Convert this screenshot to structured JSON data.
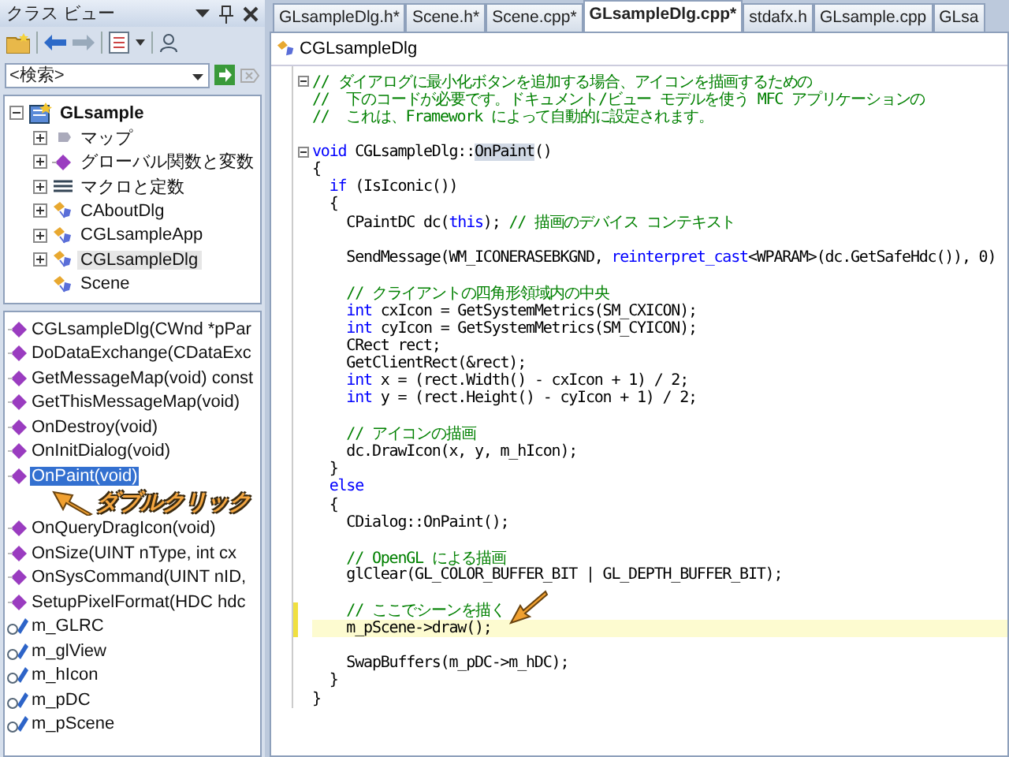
{
  "class_view": {
    "title": "クラス ビュー",
    "search": {
      "placeholder": "<検索>"
    },
    "tree": [
      {
        "label": "GLsample",
        "kind": "project",
        "expanded": true,
        "selected": false,
        "children": [
          {
            "label": "マップ",
            "kind": "map",
            "expanded": false,
            "selected": false
          },
          {
            "label": "グローバル関数と変数",
            "kind": "global",
            "expanded": false,
            "selected": false
          },
          {
            "label": "マクロと定数",
            "kind": "macro",
            "expanded": false,
            "selected": false
          },
          {
            "label": "CAboutDlg",
            "kind": "class",
            "expanded": false,
            "selected": false
          },
          {
            "label": "CGLsampleApp",
            "kind": "class",
            "expanded": false,
            "selected": false
          },
          {
            "label": "CGLsampleDlg",
            "kind": "class",
            "expanded": false,
            "selected": true
          },
          {
            "label": "Scene",
            "kind": "class",
            "selected": false
          }
        ]
      }
    ],
    "members": [
      {
        "label": "CGLsampleDlg(CWnd *pPar",
        "kind": "method",
        "selected": false
      },
      {
        "label": "DoDataExchange(CDataExc",
        "kind": "method",
        "selected": false
      },
      {
        "label": "GetMessageMap(void) const",
        "kind": "method",
        "selected": false
      },
      {
        "label": "GetThisMessageMap(void)",
        "kind": "method",
        "selected": false
      },
      {
        "label": "OnDestroy(void)",
        "kind": "method",
        "selected": false
      },
      {
        "label": "OnInitDialog(void)",
        "kind": "method",
        "selected": false
      },
      {
        "label": "OnPaint(void)",
        "kind": "method",
        "selected": true
      },
      {
        "label": "OnQueryDragIcon(void)",
        "kind": "method",
        "selected": false
      },
      {
        "label": "OnSize(UINT nType, int cx",
        "kind": "method",
        "selected": false
      },
      {
        "label": "OnSysCommand(UINT nID,",
        "kind": "method",
        "selected": false
      },
      {
        "label": "SetupPixelFormat(HDC hdc",
        "kind": "method",
        "selected": false
      },
      {
        "label": "m_GLRC",
        "kind": "field",
        "selected": false
      },
      {
        "label": "m_glView",
        "kind": "field",
        "selected": false
      },
      {
        "label": "m_hIcon",
        "kind": "field",
        "selected": false
      },
      {
        "label": "m_pDC",
        "kind": "field",
        "selected": false
      },
      {
        "label": "m_pScene",
        "kind": "field",
        "selected": false
      }
    ],
    "annotation": "ダブルクリック"
  },
  "editor": {
    "tabs": [
      {
        "label": "GLsampleDlg.h*",
        "selected": false
      },
      {
        "label": "Scene.h*",
        "selected": false
      },
      {
        "label": "Scene.cpp*",
        "selected": false
      },
      {
        "label": "GLsampleDlg.cpp*",
        "selected": true
      },
      {
        "label": "stdafx.h",
        "selected": false
      },
      {
        "label": "GLsample.cpp",
        "selected": false
      },
      {
        "label": "GLsa",
        "selected": false
      }
    ],
    "scope": "CGLsampleDlg",
    "lines": [
      {
        "fold": true,
        "changed": false,
        "highlighted": false,
        "segments": [
          {
            "kind": "comment",
            "text": "// ダイアログに最小化ボタンを追加する場合、アイコンを描画するための"
          }
        ]
      },
      {
        "fold": false,
        "changed": false,
        "highlighted": false,
        "segments": [
          {
            "kind": "comment",
            "text": "//  下のコードが必要です。ドキュメント/ビュー モデルを使う MFC アプリケーションの"
          }
        ]
      },
      {
        "fold": false,
        "changed": false,
        "highlighted": false,
        "segments": [
          {
            "kind": "comment",
            "text": "//  これは、Framework によって自動的に設定されます。"
          }
        ]
      },
      {
        "fold": false,
        "changed": false,
        "highlighted": false
      },
      {
        "fold": true,
        "changed": false,
        "highlighted": false,
        "segments": [
          {
            "kind": "keyword",
            "text": "void"
          },
          {
            "kind": "plain",
            "text": " CGLsampleDlg::"
          },
          {
            "kind": "selection",
            "text": "OnPaint"
          },
          {
            "kind": "plain",
            "text": "()"
          }
        ]
      },
      {
        "fold": false,
        "changed": false,
        "highlighted": false,
        "segments": [
          {
            "kind": "plain",
            "text": "{"
          }
        ]
      },
      {
        "fold": false,
        "changed": false,
        "highlighted": false,
        "segments": [
          {
            "kind": "keyword",
            "text": "  if"
          },
          {
            "kind": "plain",
            "text": " (IsIconic())"
          }
        ]
      },
      {
        "fold": false,
        "changed": false,
        "highlighted": false,
        "segments": [
          {
            "kind": "plain",
            "text": "  {"
          }
        ]
      },
      {
        "fold": false,
        "changed": false,
        "highlighted": false,
        "segments": [
          {
            "kind": "plain",
            "text": "    CPaintDC dc("
          },
          {
            "kind": "keyword",
            "text": "this"
          },
          {
            "kind": "plain",
            "text": "); "
          },
          {
            "kind": "comment",
            "text": "// 描画のデバイス コンテキスト"
          }
        ]
      },
      {
        "fold": false,
        "changed": false,
        "highlighted": false
      },
      {
        "fold": false,
        "changed": false,
        "highlighted": false,
        "segments": [
          {
            "kind": "plain",
            "text": "    SendMessage(WM_ICONERASEBKGND, "
          },
          {
            "kind": "keyword",
            "text": "reinterpret_cast"
          },
          {
            "kind": "plain",
            "text": "<WPARAM>(dc.GetSafeHdc()), 0)"
          }
        ]
      },
      {
        "fold": false,
        "changed": false,
        "highlighted": false
      },
      {
        "fold": false,
        "changed": false,
        "highlighted": false,
        "segments": [
          {
            "kind": "comment",
            "text": "    // クライアントの四角形領域内の中央"
          }
        ]
      },
      {
        "fold": false,
        "changed": false,
        "highlighted": false,
        "segments": [
          {
            "kind": "keyword",
            "text": "    int"
          },
          {
            "kind": "plain",
            "text": " cxIcon = GetSystemMetrics(SM_CXICON);"
          }
        ]
      },
      {
        "fold": false,
        "changed": false,
        "highlighted": false,
        "segments": [
          {
            "kind": "keyword",
            "text": "    int"
          },
          {
            "kind": "plain",
            "text": " cyIcon = GetSystemMetrics(SM_CYICON);"
          }
        ]
      },
      {
        "fold": false,
        "changed": false,
        "highlighted": false,
        "segments": [
          {
            "kind": "plain",
            "text": "    CRect rect;"
          }
        ]
      },
      {
        "fold": false,
        "changed": false,
        "highlighted": false,
        "segments": [
          {
            "kind": "plain",
            "text": "    GetClientRect(&rect);"
          }
        ]
      },
      {
        "fold": false,
        "changed": false,
        "highlighted": false,
        "segments": [
          {
            "kind": "keyword",
            "text": "    int"
          },
          {
            "kind": "plain",
            "text": " x = (rect.Width() - cxIcon + 1) / 2;"
          }
        ]
      },
      {
        "fold": false,
        "changed": false,
        "highlighted": false,
        "segments": [
          {
            "kind": "keyword",
            "text": "    int"
          },
          {
            "kind": "plain",
            "text": " y = (rect.Height() - cyIcon + 1) / 2;"
          }
        ]
      },
      {
        "fold": false,
        "changed": false,
        "highlighted": false
      },
      {
        "fold": false,
        "changed": false,
        "highlighted": false,
        "segments": [
          {
            "kind": "comment",
            "text": "    // アイコンの描画"
          }
        ]
      },
      {
        "fold": false,
        "changed": false,
        "highlighted": false,
        "segments": [
          {
            "kind": "plain",
            "text": "    dc.DrawIcon(x, y, m_hIcon);"
          }
        ]
      },
      {
        "fold": false,
        "changed": false,
        "highlighted": false,
        "segments": [
          {
            "kind": "plain",
            "text": "  }"
          }
        ]
      },
      {
        "fold": false,
        "changed": false,
        "highlighted": false,
        "segments": [
          {
            "kind": "keyword",
            "text": "  else"
          }
        ]
      },
      {
        "fold": false,
        "changed": false,
        "highlighted": false,
        "segments": [
          {
            "kind": "plain",
            "text": "  {"
          }
        ]
      },
      {
        "fold": false,
        "changed": false,
        "highlighted": false,
        "segments": [
          {
            "kind": "plain",
            "text": "    CDialog::OnPaint();"
          }
        ]
      },
      {
        "fold": false,
        "changed": false,
        "highlighted": false
      },
      {
        "fold": false,
        "changed": false,
        "highlighted": false,
        "segments": [
          {
            "kind": "comment",
            "text": "    // OpenGL による描画"
          }
        ]
      },
      {
        "fold": false,
        "changed": false,
        "highlighted": false,
        "segments": [
          {
            "kind": "plain",
            "text": "    glClear(GL_COLOR_BUFFER_BIT | GL_DEPTH_BUFFER_BIT);"
          }
        ]
      },
      {
        "fold": false,
        "changed": false,
        "highlighted": false
      },
      {
        "fold": false,
        "changed": true,
        "highlighted": false,
        "segments": [
          {
            "kind": "comment",
            "text": "    // ここでシーンを描く"
          }
        ]
      },
      {
        "fold": false,
        "changed": true,
        "highlighted": true,
        "segments": [
          {
            "kind": "plain",
            "text": "    m_pScene->draw();"
          }
        ]
      },
      {
        "fold": false,
        "changed": false,
        "highlighted": false
      },
      {
        "fold": false,
        "changed": false,
        "highlighted": false,
        "segments": [
          {
            "kind": "plain",
            "text": "    SwapBuffers(m_pDC->m_hDC);"
          }
        ]
      },
      {
        "fold": false,
        "changed": false,
        "highlighted": false,
        "segments": [
          {
            "kind": "plain",
            "text": "  }"
          }
        ]
      },
      {
        "fold": false,
        "changed": false,
        "highlighted": false,
        "segments": [
          {
            "kind": "plain",
            "text": "}"
          }
        ]
      }
    ]
  }
}
